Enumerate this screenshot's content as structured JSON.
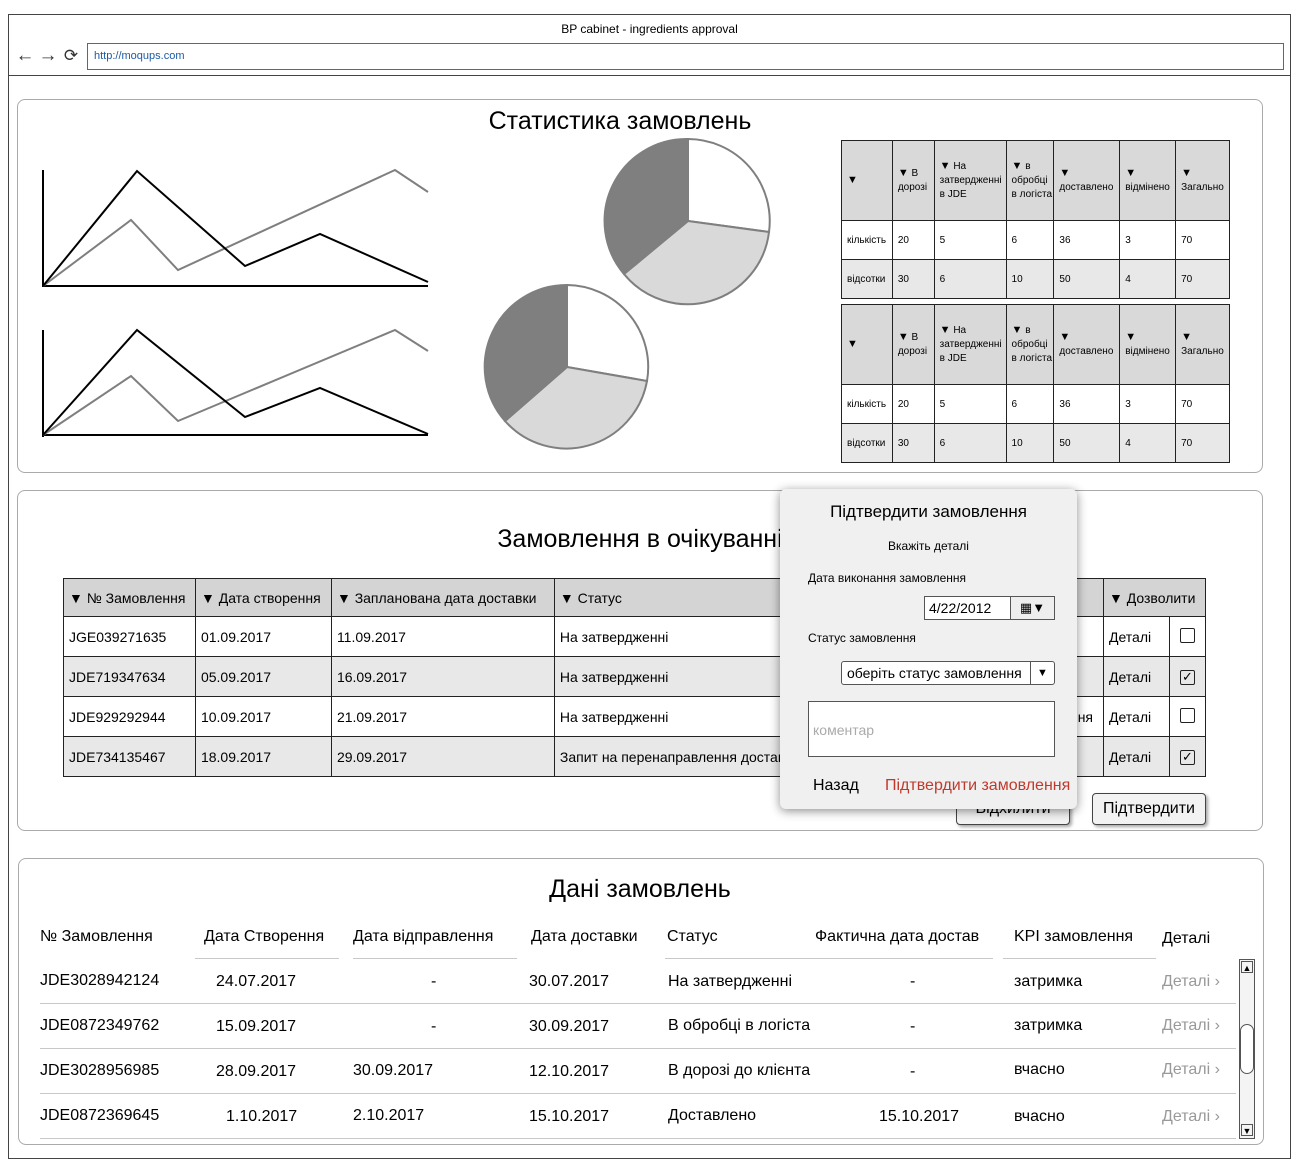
{
  "window": {
    "title": "BP cabinet - ingredients approval",
    "url": "http://moqups.com"
  },
  "statistics": {
    "title": "Статистика замовлень",
    "tables": [
      {
        "headers": [
          "",
          "В дорозі",
          "На затвердженні в JDE",
          "в обробці в логіста",
          "доставлено",
          "відмінено",
          "Загально"
        ],
        "rows": [
          [
            "кількість",
            "20",
            "5",
            "6",
            "36",
            "3",
            "70"
          ],
          [
            "відсотки",
            "30",
            "6",
            "10",
            "50",
            "4",
            "70"
          ]
        ]
      },
      {
        "headers": [
          "",
          "В дорозі",
          "На затвердженні в JDE",
          "в обробці в логіста",
          "доставлено",
          "відмінено",
          "Загально"
        ],
        "rows": [
          [
            "кількість",
            "20",
            "5",
            "6",
            "36",
            "3",
            "70"
          ],
          [
            "відсотки",
            "30",
            "6",
            "10",
            "50",
            "4",
            "70"
          ]
        ]
      }
    ]
  },
  "pending": {
    "title": "Замовлення в очікуванні",
    "headers": [
      "№ Замовлення",
      "Дата створення",
      "Запланована дата доставки",
      "Статус",
      "Дозволити"
    ],
    "rows": [
      {
        "id": "JGE039271635",
        "created": "01.09.2017",
        "planned": "11.09.2017",
        "status": "На затвердженні",
        "hidden": "",
        "details": "Деталі",
        "checked": false
      },
      {
        "id": "JDE719347634",
        "created": "05.09.2017",
        "planned": "16.09.2017",
        "status": "На затвердженні",
        "hidden": "",
        "details": "Деталі",
        "checked": true
      },
      {
        "id": "JDE929292944",
        "created": "10.09.2017",
        "planned": "21.09.2017",
        "status": "На затвердженні",
        "hidden": "ня",
        "details": "Деталі",
        "checked": false
      },
      {
        "id": "JDE734135467",
        "created": "18.09.2017",
        "planned": "29.09.2017",
        "status": "Запит на перенаправлення доставки",
        "hidden": "",
        "details": "Деталі",
        "checked": true
      }
    ],
    "reject_label": "Відхилити",
    "approve_label": "Підтвердити"
  },
  "popup": {
    "title": "Підтвердити замовлення",
    "subtitle": "Вкажіть деталі",
    "date_label": "Дата виконання замовлення",
    "date_value": "4/22/2012",
    "status_label": "Статус замовлення",
    "status_select": "оберіть статус замовлення",
    "comment_placeholder": "коментар",
    "back_label": "Назад",
    "confirm_label": "Підтвердити замовлення",
    "confirm_color": "#c0392b"
  },
  "order_data": {
    "title": "Дані замовлень",
    "headers": [
      "№ Замовлення",
      "Дата Створення",
      "Дата відправлення",
      "Дата доставки",
      "Статус",
      "Фактична дата достав",
      "KPI замовлення",
      "Деталі"
    ],
    "rows": [
      {
        "id": "JDE3028942124",
        "created": "24.07.2017",
        "sent": "-",
        "delivery": "30.07.2017",
        "status": "На затвердженні",
        "actual": "-",
        "kpi": "затримка",
        "details": "Деталі"
      },
      {
        "id": "JDE0872349762",
        "created": "15.09.2017",
        "sent": "-",
        "delivery": "30.09.2017",
        "status": "В обробці в логіста",
        "actual": "-",
        "kpi": "затримка",
        "details": "Деталі"
      },
      {
        "id": "JDE3028956985",
        "created": "28.09.2017",
        "sent": "30.09.2017",
        "delivery": "12.10.2017",
        "status": "В дорозі до клієнта",
        "actual": "-",
        "kpi": "вчасно",
        "details": "Деталі"
      },
      {
        "id": "JDE0872369645",
        "created": "1.10.2017",
        "sent": "2.10.2017",
        "delivery": "15.10.2017",
        "status": "Доставлено",
        "actual": "15.10.2017",
        "kpi": "вчасно",
        "details": "Деталі"
      }
    ]
  }
}
